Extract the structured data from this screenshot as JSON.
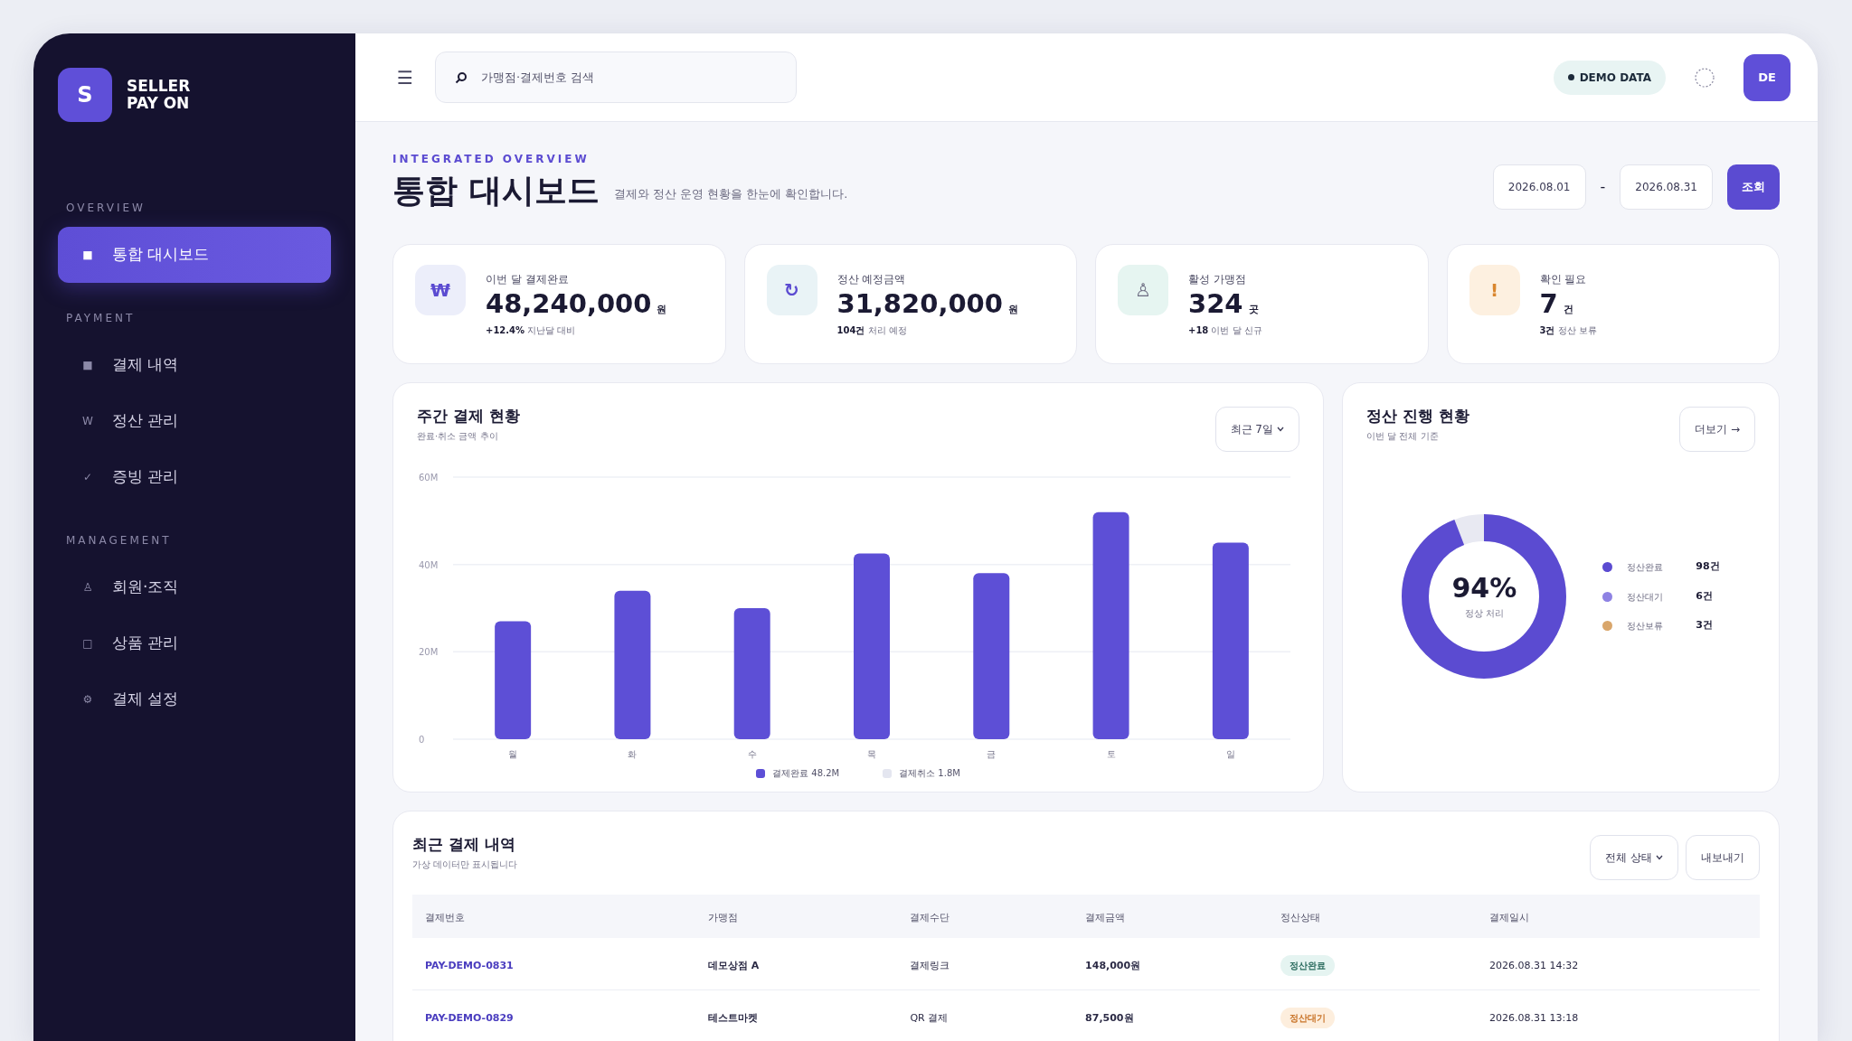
{
  "sidebar": {
    "logo_letter": "S",
    "brand_lines": [
      "SELLER",
      "PAY ON"
    ],
    "sections": [
      {
        "title": "OVERVIEW",
        "items": [
          {
            "icon": "■",
            "label": "통합 대시보드",
            "selected": true
          }
        ]
      },
      {
        "title": "PAYMENT",
        "items": [
          {
            "icon": "■",
            "label": "결제 내역",
            "selected": false
          },
          {
            "icon": "W",
            "label": "정산 관리",
            "selected": false
          },
          {
            "icon": "✓",
            "label": "증빙 관리",
            "selected": false
          }
        ]
      },
      {
        "title": "MANAGEMENT",
        "items": [
          {
            "icon": "♙",
            "label": "회원·조직",
            "selected": false
          },
          {
            "icon": "□",
            "label": "상품 관리",
            "selected": false
          },
          {
            "icon": "⚙",
            "label": "결제 설정",
            "selected": false
          }
        ]
      }
    ]
  },
  "topbar": {
    "menu_icon": "☰",
    "search": {
      "placeholder": "가맹점·결제번호 검색"
    },
    "badge": "DEMO DATA",
    "avatar": "DE"
  },
  "page": {
    "eyebrow": "INTEGRATED OVERVIEW",
    "title": "통합 대시보드",
    "subtitle": "결제와 정산 운영 현황을 한눈에 확인합니다.",
    "date_from": "2026.08.01",
    "date_separator": "-",
    "date_to": "2026.08.31",
    "query_button": "조회"
  },
  "kpis": [
    {
      "kind": "purple",
      "icon": "₩",
      "label": "이번 달 결제완료",
      "value": "48,240,000",
      "unit": "원",
      "note": "**+12.4%** 지난달 대비"
    },
    {
      "kind": "teal",
      "icon": "↻",
      "label": "정산 예정금액",
      "value": "31,820,000",
      "unit": "원",
      "note": "**104건** 처리 예정"
    },
    {
      "kind": "mint",
      "icon": "♙",
      "label": "활성 가맹점",
      "value": "324",
      "unit": "곳",
      "note": "**+18** 이번 달 신규"
    },
    {
      "kind": "amber",
      "icon": "!",
      "label": "확인 필요",
      "value": "7",
      "unit": "건",
      "note": "**3건** 정산 보류"
    }
  ],
  "weekly_card": {
    "title": "주간 결제 현황",
    "subtitle": "완료·취소 금액 추이",
    "range_button": "최근 7일",
    "chart_data": {
      "type": "bar",
      "categories": [
        "월",
        "화",
        "수",
        "목",
        "금",
        "토",
        "일"
      ],
      "ylim": [
        0,
        60
      ],
      "yticks": [
        {
          "value": 0,
          "label": "0"
        },
        {
          "value": 20,
          "label": "20M"
        },
        {
          "value": 40,
          "label": "40M"
        },
        {
          "value": 60,
          "label": "60M"
        }
      ],
      "series": [
        {
          "name": "결제완료",
          "color": "#5d4fd6",
          "values": [
            27,
            34,
            30,
            42.5,
            38,
            52,
            45
          ]
        },
        {
          "name": "결제취소",
          "color": "#e4e6f0",
          "values": [
            null,
            null,
            null,
            null,
            null,
            null,
            null
          ]
        }
      ]
    },
    "legend_totals": [
      "48.2M",
      "1.8M"
    ]
  },
  "settlement_card": {
    "title": "정산 진행 현황",
    "subtitle": "이번 달 전체 기준",
    "more_button": "더보기 →",
    "level": 0.94,
    "percent": "94%",
    "caption": "정상 처리",
    "legend": [
      {
        "label": "정산완료",
        "count": "98건",
        "color": "#5b4bd1"
      },
      {
        "label": "정산대기",
        "count": "6건",
        "color": "#8e82e3"
      },
      {
        "label": "정산보류",
        "count": "3건",
        "color": "#d9a66b"
      }
    ]
  },
  "recent_card": {
    "title": "최근 결제 내역",
    "subtitle": "가상 데이터만 표시됩니다",
    "filter_button": "전체 상태",
    "export_button": "내보내기",
    "columns": [
      "결제번호",
      "가맹점",
      "결제수단",
      "결제금액",
      "정산상태",
      "결제일시"
    ],
    "rows": [
      {
        "id": "PAY-DEMO-0831",
        "merchant": "데모상점 A",
        "method": "결제링크",
        "amount": "148,000원",
        "status": "정산완료",
        "kind": "done",
        "datetime": "2026.08.31 14:32"
      },
      {
        "id": "PAY-DEMO-0829",
        "merchant": "테스트마켓",
        "method": "QR 결제",
        "amount": "87,500원",
        "status": "정산대기",
        "kind": "pending",
        "datetime": "2026.08.31 13:18"
      }
    ]
  }
}
